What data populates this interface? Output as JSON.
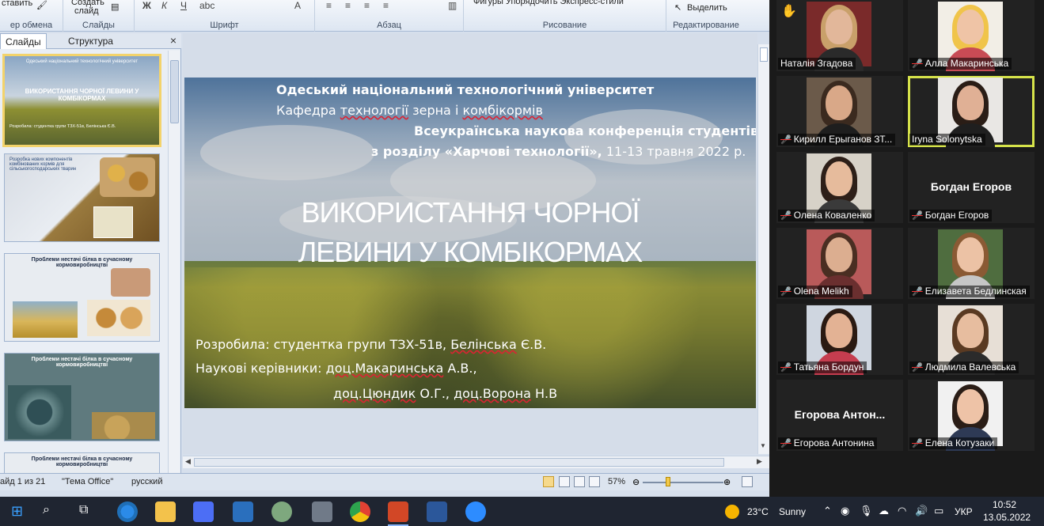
{
  "ribbon": {
    "clipboard_paste": "ставить",
    "clipboard_format": "ер обмена",
    "new_slide": "Создать",
    "new_slide2": "слайд",
    "slides_group": "Слайды",
    "font_group": "Шрифт",
    "paragraph_group": "Абзац",
    "drawing_group": "Рисование",
    "shapes": "Фигуры Упорядочить Экспресс-стили",
    "select": "Выделить",
    "editing_group": "Редактирование"
  },
  "left_pane": {
    "tab_slides": "Слайды",
    "tab_outline": "Структура",
    "close": "×",
    "thumbs": [
      {
        "title": "ВИКОРИСТАННЯ ЧОРНОЇ ЛЕВИНИ У КОМБІКОРМАХ",
        "top_text": "Одеський національний технологічний університет",
        "bottom_text": "Розробила: студентка групи ТЗХ-51в, Белінська Є.В."
      },
      {
        "title": "Розробка нових компонентів комбінованих кормів для сільськогосподарських тварин",
        "top_text": "",
        "bottom_text": ""
      },
      {
        "title": "Проблеми нестачі білка в сучасному кормовиробництві",
        "top_text": "",
        "bottom_text": ""
      },
      {
        "title": "Проблеми нестачі білка в сучасному кормовиробництві",
        "top_text": "",
        "bottom_text": ""
      },
      {
        "title": "Проблеми нестачі білка в сучасному кормовиробництві",
        "top_text": "",
        "bottom_text": ""
      }
    ]
  },
  "slide": {
    "line1": "Одеський національний  технологічний  університет",
    "line2_a": "Кафедра ",
    "line2_b": "технології",
    "line2_c": " зерна  і ",
    "line2_d": "комбікормів",
    "line3": "Всеукраїнська  наукова  конференція  студентів",
    "line4_a": "з розділу «Харчові технології»,",
    "line4_b": " 11-13 травня 2022 р.",
    "title1": "ВИКОРИСТАННЯ ЧОРНОЇ",
    "title2": "ЛЕВИНИ У КОМБІКОРМАХ",
    "author_a": "Розробила: студентка групи ТЗХ-51в, ",
    "author_b": "Белінська",
    "author_c": " Є.В.",
    "sup1_a": "Наукові керівники: ",
    "sup1_b": "доц.Макаринська",
    "sup1_c": " А.В.,",
    "sup2_a": "доц.Цюндик",
    "sup2_b": "  О.Г., ",
    "sup2_c": "доц.Ворона",
    "sup2_d": "  Н.В"
  },
  "status": {
    "slide_num": "айд 1 из 21",
    "theme": "\"Тема Office\"",
    "lang": "русский",
    "zoom": "57%",
    "zoom_fraction": 0.3
  },
  "gallery": [
    {
      "name": "Наталія Згадова",
      "muted": false,
      "hand": true,
      "big": "",
      "col": 0,
      "row": 0
    },
    {
      "name": "Алла Макаринська",
      "muted": true,
      "hand": false,
      "big": "",
      "col": 1,
      "row": 0
    },
    {
      "name": "Кирилл Ерыганов ЗТ...",
      "muted": true,
      "hand": false,
      "big": "",
      "col": 0,
      "row": 1
    },
    {
      "name": "Iryna Solonytska",
      "muted": false,
      "hand": false,
      "big": "",
      "col": 1,
      "row": 1,
      "speaking": true
    },
    {
      "name": "Олена Коваленко",
      "muted": true,
      "hand": false,
      "big": "",
      "col": 0,
      "row": 2
    },
    {
      "name": "Богдан Егоров",
      "muted": true,
      "hand": false,
      "big": "Богдан Егоров",
      "col": 1,
      "row": 2
    },
    {
      "name": "Olena Melikh",
      "muted": true,
      "hand": false,
      "big": "",
      "col": 0,
      "row": 3
    },
    {
      "name": "Елизавета Бедлинская",
      "muted": true,
      "hand": false,
      "big": "",
      "col": 1,
      "row": 3
    },
    {
      "name": "Татьяна Бордун",
      "muted": true,
      "hand": false,
      "big": "",
      "col": 0,
      "row": 4
    },
    {
      "name": "Людмила Валевська",
      "muted": true,
      "hand": false,
      "big": "",
      "col": 1,
      "row": 4
    },
    {
      "name": "Егорова Антонина",
      "muted": true,
      "hand": false,
      "big": "Егорова  Антон...",
      "col": 0,
      "row": 5
    },
    {
      "name": "Елена Котузаки",
      "muted": true,
      "hand": false,
      "big": "",
      "col": 1,
      "row": 5
    }
  ],
  "taskbar": {
    "weather_temp": "23°C",
    "weather_desc": "Sunny",
    "lang": "УКР",
    "time": "10:52",
    "date": "13.05.2022"
  }
}
